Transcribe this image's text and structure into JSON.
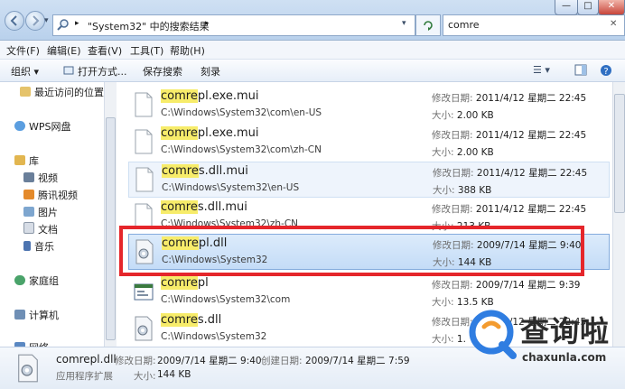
{
  "address": {
    "breadcrumb_sep": "▸",
    "path_text": "\"System32\" 中的搜索结果",
    "dropdown": "▾"
  },
  "search": {
    "value": "comre",
    "clear": "✕"
  },
  "window_buttons": {
    "minimize": "—",
    "maximize": "□",
    "close": "✕"
  },
  "menu": [
    {
      "label": "文件(F)"
    },
    {
      "label": "编辑(E)"
    },
    {
      "label": "查看(V)"
    },
    {
      "label": "工具(T)"
    },
    {
      "label": "帮助(H)"
    }
  ],
  "toolbar": {
    "organize": "组织 ▾",
    "open_with": "打开方式...",
    "save_search": "保存搜索",
    "burn": "刻录",
    "view_toggle": "☰ ▾"
  },
  "nav": {
    "recent": "最近访问的位置",
    "wps": "WPS网盘",
    "libraries": "库",
    "videos": "视频",
    "tencent_video": "腾讯视频",
    "pictures": "图片",
    "documents": "文档",
    "music": "音乐",
    "homegroup": "家庭组",
    "computer": "计算机",
    "network": "网络"
  },
  "labels": {
    "modified": "修改日期:",
    "size": "大小:"
  },
  "results": [
    {
      "hl": "comre",
      "rest": "pl.exe.mui",
      "path": "C:\\Windows\\System32\\com\\en-US",
      "date": "2011/4/12 星期二 22:45",
      "size": "2.00 KB"
    },
    {
      "hl": "comre",
      "rest": "pl.exe.mui",
      "path": "C:\\Windows\\System32\\com\\zh-CN",
      "date": "2011/4/12 星期二 22:45",
      "size": "2.00 KB"
    },
    {
      "hl": "comre",
      "rest": "s.dll.mui",
      "path": "C:\\Windows\\System32\\en-US",
      "date": "2011/4/12 星期二 22:45",
      "size": "388 KB"
    },
    {
      "hl": "comre",
      "rest": "s.dll.mui",
      "path": "C:\\Windows\\System32\\zh-CN",
      "date": "2011/4/12 星期二 22:45",
      "size": "213 KB"
    },
    {
      "hl": "comre",
      "rest": "pl.dll",
      "path": "C:\\Windows\\System32",
      "date": "2009/7/14 星期二 9:40",
      "size": "144 KB"
    },
    {
      "hl": "comre",
      "rest": "pl",
      "path": "C:\\Windows\\System32\\com",
      "date": "2009/7/14 星期二 9:39",
      "size": "13.5 KB"
    },
    {
      "hl": "comre",
      "rest": "s.dll",
      "path": "C:\\Windows\\System32",
      "date": "2011/4/12 星期二 22:45",
      "size": "1."
    }
  ],
  "details": {
    "filename": "comrepl.dll",
    "modified_label": "修改日期:",
    "modified": "2009/7/14 星期二 9:40",
    "created_label": "创建日期:",
    "created": "2009/7/14 星期二 7:59",
    "type": "应用程序扩展",
    "size_label": "大小:",
    "size": "144 KB"
  },
  "watermark": {
    "brand": "查询啦",
    "url": "chaxunla.com"
  },
  "colors": {
    "highlight": "#f7ec6a",
    "selection": "#c4dcf7",
    "annotation_box": "#e5262b",
    "watermark": "#2f7de1"
  }
}
